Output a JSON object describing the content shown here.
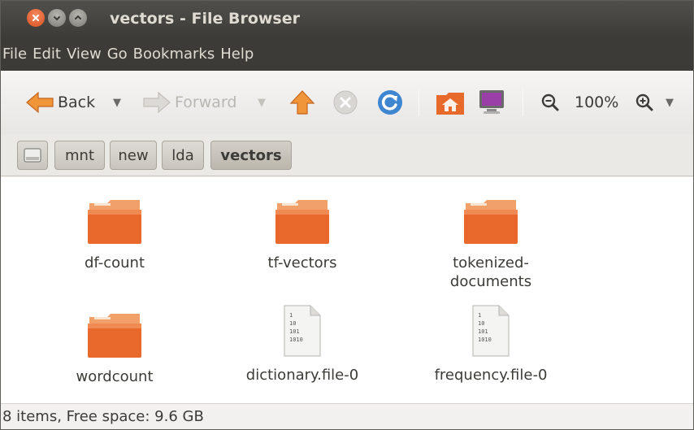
{
  "window": {
    "title": "vectors - File Browser"
  },
  "menubar": {
    "items": [
      "File",
      "Edit",
      "View",
      "Go",
      "Bookmarks",
      "Help"
    ]
  },
  "toolbar": {
    "back_label": "Back",
    "forward_label": "Forward",
    "zoom_level": "100%",
    "icons": [
      "back-arrow-icon",
      "up-arrow-icon",
      "stop-icon",
      "reload-icon",
      "home-folder-icon",
      "computer-icon",
      "zoom-out-icon",
      "zoom-in-icon"
    ]
  },
  "pathbar": {
    "crumbs": [
      "mnt",
      "new",
      "lda",
      "vectors"
    ],
    "active": "vectors"
  },
  "files": [
    {
      "name": "df-count",
      "type": "folder"
    },
    {
      "name": "tf-vectors",
      "type": "folder"
    },
    {
      "name": "tokenized-\ndocuments",
      "type": "folder"
    },
    {
      "name": "wordcount",
      "type": "folder"
    },
    {
      "name": "dictionary.file-0",
      "type": "binary",
      "preview": [
        "1",
        "10",
        "101",
        "1010"
      ]
    },
    {
      "name": "frequency.file-0",
      "type": "binary",
      "preview": [
        "1",
        "10",
        "101",
        "1010"
      ]
    }
  ],
  "status": {
    "text": "8 items, Free space: 9.6 GB"
  },
  "colors": {
    "folder": "#e9692c",
    "titlebar": "#3c3b37",
    "accent": "#dd4814"
  }
}
